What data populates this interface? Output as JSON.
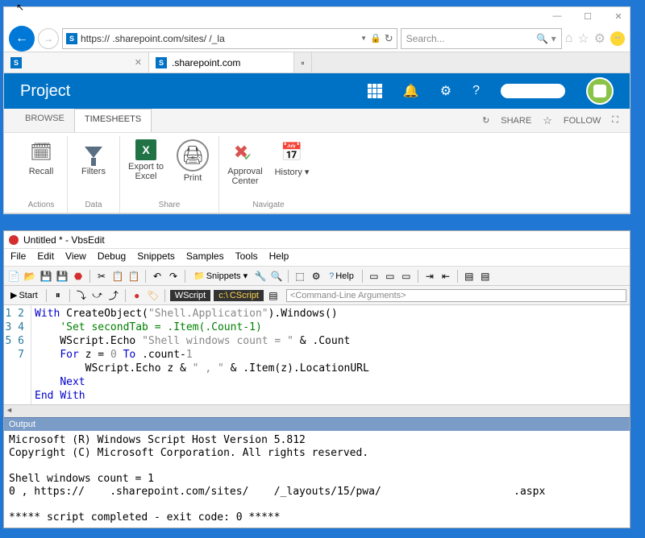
{
  "cursor": "↖",
  "ie": {
    "win_buttons": {
      "min": "—",
      "max": "☐",
      "close": "✕"
    },
    "url": "https://    .sharepoint.com/sites/    /_la",
    "search_placeholder": "Search...",
    "search_icon_combo": "🔍 ▾",
    "tabs": [
      {
        "label": "",
        "icon": "S"
      },
      {
        "label": ".sharepoint.com",
        "icon": "S"
      }
    ]
  },
  "sp": {
    "title": "Project",
    "icons": {
      "bell": "🔔",
      "gear": "⚙",
      "help": "?"
    },
    "ribbon_tabs": [
      "BROWSE",
      "TIMESHEETS"
    ],
    "active_tab": 1,
    "actions": {
      "share": "SHARE",
      "follow": "FOLLOW",
      "refresh": "↻",
      "star": "☆",
      "focus": "⛶"
    },
    "groups": [
      {
        "label": "Actions",
        "items": [
          {
            "name": "recall",
            "label": "Recall",
            "icon": "🗓"
          }
        ]
      },
      {
        "label": "Data",
        "items": [
          {
            "name": "filters",
            "label": "Filters",
            "icon": "funnel"
          }
        ]
      },
      {
        "label": "Share",
        "items": [
          {
            "name": "export",
            "label": "Export to Excel",
            "icon": "x"
          },
          {
            "name": "print",
            "label": "Print",
            "icon": "🖨"
          }
        ]
      },
      {
        "label": "Navigate",
        "items": [
          {
            "name": "approval",
            "label": "Approval Center",
            "icon": "✔"
          },
          {
            "name": "history",
            "label": "History ▾",
            "icon": "📅"
          }
        ]
      }
    ]
  },
  "vbs": {
    "title": "Untitled * - VbsEdit",
    "menu": [
      "File",
      "Edit",
      "View",
      "Debug",
      "Snippets",
      "Samples",
      "Tools",
      "Help"
    ],
    "toolbar1": {
      "snippets": "Snippets ▾",
      "help": "Help"
    },
    "toolbar2": {
      "start": "Start",
      "wscript": "WScript",
      "cscript": "CScript",
      "args_placeholder": "<Command-Line Arguments>"
    },
    "code_lines": [
      {
        "n": "1",
        "html": "<span class='kw'>With</span> CreateObject(<span class='str'>\"Shell.Application\"</span>).Windows()"
      },
      {
        "n": "2",
        "html": "    <span class='cmt'>'Set secondTab = .Item(.Count-1)</span>"
      },
      {
        "n": "3",
        "html": "    WScript.Echo <span class='str'>\"Shell windows count = \"</span> &amp; .Count"
      },
      {
        "n": "4",
        "html": "    <span class='kw'>For</span> z = <span class='str'>0</span> <span class='kw'>To</span> .count-<span class='str'>1</span>"
      },
      {
        "n": "5",
        "html": "        WScript.Echo z &amp; <span class='str'>\" , \"</span> &amp; .Item(z).LocationURL"
      },
      {
        "n": "6",
        "html": "    <span class='kw'>Next</span>"
      },
      {
        "n": "7",
        "html": "<span class='kw'>End</span> <span class='kw'>With</span>"
      }
    ],
    "output_header": "Output",
    "output_body": "Microsoft (R) Windows Script Host Version 5.812\nCopyright (C) Microsoft Corporation. All rights reserved.\n\nShell windows count = 1\n0 , https://    .sharepoint.com/sites/    /_layouts/15/pwa/                     .aspx\n\n***** script completed - exit code: 0 *****"
  }
}
